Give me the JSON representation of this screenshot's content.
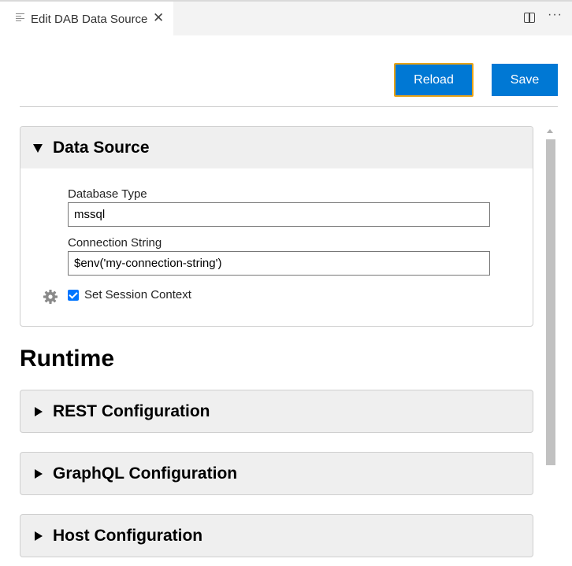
{
  "tab": {
    "title": "Edit DAB Data Source",
    "close_glyph": "✕",
    "icon": "file-lines-icon"
  },
  "editor_actions": {
    "split_icon": "split-editor-icon",
    "more_glyph": "···"
  },
  "toolbar": {
    "reload_label": "Reload",
    "save_label": "Save",
    "accent_color": "#0078d4",
    "focus_ring_color": "#e8a317"
  },
  "data_source": {
    "title": "Data Source",
    "expanded": true,
    "database_type_label": "Database Type",
    "database_type_value": "mssql",
    "connection_string_label": "Connection String",
    "connection_string_value": "$env('my-connection-string')",
    "session_context_label": "Set Session Context",
    "session_context_checked": true,
    "settings_icon": "gear-icon"
  },
  "runtime": {
    "heading": "Runtime",
    "sections": [
      {
        "title": "REST Configuration",
        "expanded": false
      },
      {
        "title": "GraphQL Configuration",
        "expanded": false
      },
      {
        "title": "Host Configuration",
        "expanded": false
      }
    ]
  }
}
